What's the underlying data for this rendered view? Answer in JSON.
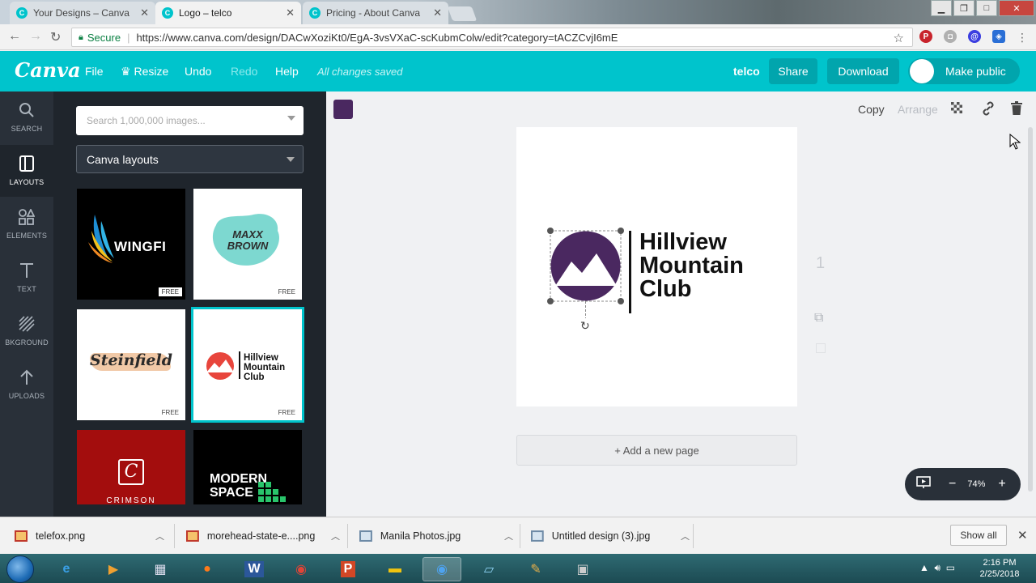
{
  "browser": {
    "tabs": [
      {
        "title": "Your Designs – Canva",
        "active": false
      },
      {
        "title": "Logo – telco",
        "active": true
      },
      {
        "title": "Pricing - About Canva",
        "active": false
      }
    ],
    "secure_label": "Secure",
    "url": "https://www.canva.com/design/DACwXoziKt0/EgA-3vsVXaC-scKubmColw/edit?category=tACZCvjI6mE"
  },
  "topbar": {
    "logo": "Canva",
    "file": "File",
    "resize": "Resize",
    "undo": "Undo",
    "redo": "Redo",
    "help": "Help",
    "status": "All changes saved",
    "team": "telco",
    "share": "Share",
    "download": "Download",
    "make_public": "Make public"
  },
  "rail": [
    {
      "label": "SEARCH",
      "icon": "search-icon"
    },
    {
      "label": "LAYOUTS",
      "icon": "layouts-icon"
    },
    {
      "label": "ELEMENTS",
      "icon": "elements-icon"
    },
    {
      "label": "TEXT",
      "icon": "text-icon"
    },
    {
      "label": "BKGROUND",
      "icon": "background-icon"
    },
    {
      "label": "UPLOADS",
      "icon": "uploads-icon"
    }
  ],
  "panel": {
    "search_placeholder": "Search 1,000,000 images...",
    "category": "Canva layouts",
    "free_badge": "FREE",
    "layouts": [
      {
        "name": "WINGFI",
        "bg": "#000000"
      },
      {
        "name": "MAXX BROWN",
        "bg": "#ffffff"
      },
      {
        "name": "Steinfield",
        "bg": "#ffffff"
      },
      {
        "name": "Hillview Mountain Club",
        "bg": "#ffffff"
      },
      {
        "name": "CRIMSON",
        "bg": "#a30d0d"
      },
      {
        "name": "MODERN SPACE",
        "bg": "#000000"
      }
    ],
    "maxx_line1": "MAXX",
    "maxx_line2": "BROWN"
  },
  "editor": {
    "swatch_color": "#4a2860",
    "copy": "Copy",
    "arrange": "Arrange",
    "logo_line1": "Hillview",
    "logo_line2": "Mountain",
    "logo_line3": "Club",
    "page_number": "1",
    "add_page": "+ Add a new page",
    "zoom": "74%"
  },
  "downloads": [
    {
      "name": "telefox.png"
    },
    {
      "name": "morehead-state-e....png"
    },
    {
      "name": "Manila Photos.jpg"
    },
    {
      "name": "Untitled design (3).jpg"
    }
  ],
  "downloads_show_all": "Show all",
  "taskbar": {
    "time": "2:16 PM",
    "date": "2/25/2018"
  },
  "colors": {
    "canva_teal": "#00c4cc",
    "rail_bg": "#293039",
    "logo_purple": "#4a2860",
    "accent_red": "#e8453c"
  }
}
